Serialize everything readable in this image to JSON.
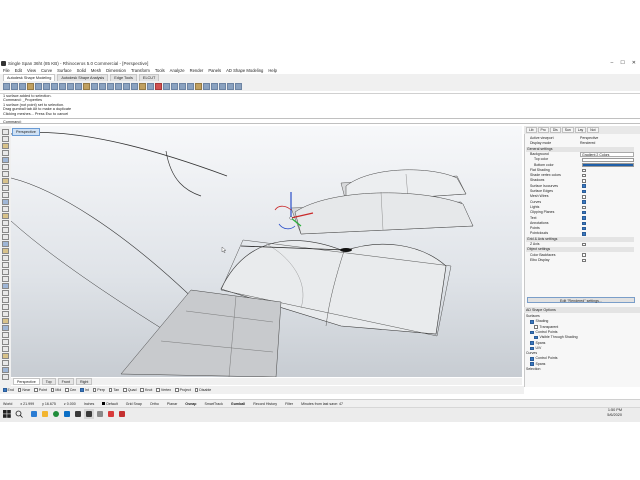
{
  "window": {
    "title": "Single Span 36ht (85 KB) - Rhinoceros 5.0 Commercial - [Perspective]",
    "controls": [
      "–",
      "☐",
      "✕"
    ]
  },
  "menu": [
    "File",
    "Edit",
    "View",
    "Curve",
    "Surface",
    "Solid",
    "Mesh",
    "Dimension",
    "Transform",
    "Tools",
    "Analyze",
    "Render",
    "Panels",
    "AD Shape Modeling",
    "Help"
  ],
  "ribbon_tabs": [
    "Autodesk Shape Modeling",
    "Autodesk Shape Analysis",
    "Edge Tools",
    "ELCUT"
  ],
  "command_history": [
    "1 surface added to selection.",
    "Command: _Properties",
    "1 surface (not point) set to selection.",
    "Drag gumball tab Alt to make a duplicate",
    "Clicking meshes... Press Esc to cancel"
  ],
  "command_prompt": "Command:",
  "viewport": {
    "label": "Perspective",
    "tabs": [
      "Perspective",
      "Top",
      "Front",
      "Right"
    ]
  },
  "osnap": [
    {
      "label": "End",
      "on": true
    },
    {
      "label": "Near",
      "on": false
    },
    {
      "label": "Point",
      "on": false
    },
    {
      "label": "Mid",
      "on": false
    },
    {
      "label": "Cen",
      "on": false
    },
    {
      "label": "Int",
      "on": true
    },
    {
      "label": "Perp",
      "on": false
    },
    {
      "label": "Tan",
      "on": false
    },
    {
      "label": "Quad",
      "on": false
    },
    {
      "label": "Knot",
      "on": false
    },
    {
      "label": "Vertex",
      "on": false
    },
    {
      "label": "Project",
      "on": false
    },
    {
      "label": "Disable",
      "on": false
    }
  ],
  "status": {
    "cplane": "World",
    "x": "x 21.999",
    "y": "y 16.675",
    "z": "z 0.000",
    "units": "Inches",
    "layer": "Default",
    "toggles": [
      "Grid Snap",
      "Ortho",
      "Planar",
      "Osnap",
      "SmartTrack",
      "Gumball",
      "Record History",
      "Filter"
    ],
    "memory": "Minutes from last save: 47"
  },
  "properties_panel": {
    "tabs": [
      "Lib",
      "Pro",
      "Dis",
      "Sun",
      "Lay",
      "Not"
    ],
    "rows": [
      {
        "key": "Active viewport",
        "value": "Perspective"
      },
      {
        "key": "Display mode",
        "value": "Rendered"
      }
    ],
    "general_header": "General settings",
    "background": {
      "key": "Background",
      "value": "Gradient 2 Colors"
    },
    "top_color": "Top color",
    "bottom_color": "Bottom color",
    "top_color_hex": "#ffffff",
    "bottom_color_hex": "#1f5fa8",
    "checks": [
      {
        "key": "Flat Shading",
        "on": false
      },
      {
        "key": "Shade vertex colors",
        "on": false
      },
      {
        "key": "Shadows",
        "on": false
      },
      {
        "key": "Surface Isocurves",
        "on": true
      },
      {
        "key": "Surface Edges",
        "on": true
      },
      {
        "key": "Mesh Wires",
        "on": false
      },
      {
        "key": "Curves",
        "on": true
      },
      {
        "key": "Lights",
        "on": false
      },
      {
        "key": "Clipping Planes",
        "on": true
      },
      {
        "key": "Text",
        "on": true
      },
      {
        "key": "Annotations",
        "on": true
      },
      {
        "key": "Points",
        "on": true
      },
      {
        "key": "Pointclouds",
        "on": true
      }
    ],
    "grid_header": "Grid & Axis settings",
    "grid_checks": [
      {
        "key": "Z Axis",
        "on": false
      }
    ],
    "object_header": "Object settings",
    "object_checks": [
      {
        "key": "Color Backfaces",
        "on": false
      },
      {
        "key": "Elbo Display",
        "on": false
      }
    ],
    "edit_button": "Edit \"Rendered\" settings...",
    "ad_header": "AD Shape Options",
    "surfaces_label": "Surfaces",
    "surface_opts": [
      {
        "key": "Shading",
        "on": true,
        "indent": 1
      },
      {
        "key": "Transparent",
        "on": false,
        "indent": 2
      },
      {
        "key": "Control Points",
        "on": true,
        "indent": 1
      },
      {
        "key": "Visible Through Shading",
        "on": true,
        "indent": 2
      },
      {
        "key": "Spans",
        "on": true,
        "indent": 1
      },
      {
        "key": "U/V",
        "on": true,
        "indent": 1
      }
    ],
    "curves_label": "Curves",
    "curve_opts": [
      {
        "key": "Control Points",
        "on": true,
        "indent": 1
      },
      {
        "key": "Spans",
        "on": true,
        "indent": 1
      }
    ],
    "selection_label": "Selection"
  },
  "taskbar": {
    "time": "1:50 PM",
    "date": "5/6/2020"
  }
}
